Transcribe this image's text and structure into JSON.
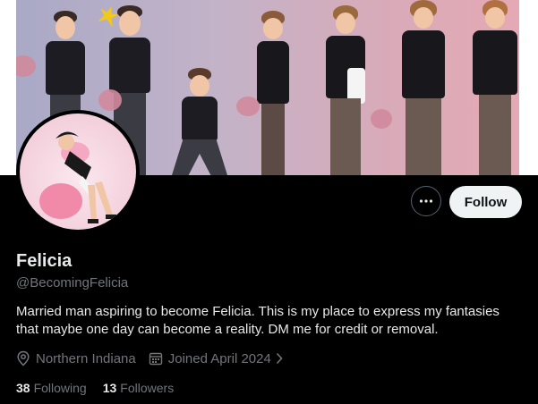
{
  "profile": {
    "display_name": "Felicia",
    "handle": "@BecomingFelicia",
    "bio": "Married man aspiring to become Felicia. This is my place to express my fantasies that maybe one day can become a reality. DM me for credit or removal.",
    "location": "Northern Indiana",
    "joined": "Joined April 2024",
    "following_count": "38",
    "following_label": "Following",
    "followers_count": "13",
    "followers_label": "Followers"
  },
  "actions": {
    "follow_label": "Follow",
    "more_icon": "more-horizontal-icon"
  },
  "icons": {
    "location": "location-pin-icon",
    "calendar": "calendar-icon",
    "chevron": "chevron-right-icon"
  },
  "colors": {
    "background": "#000000",
    "text_primary": "#e7e9ea",
    "text_secondary": "#71767b",
    "follow_bg": "#eff3f4"
  }
}
